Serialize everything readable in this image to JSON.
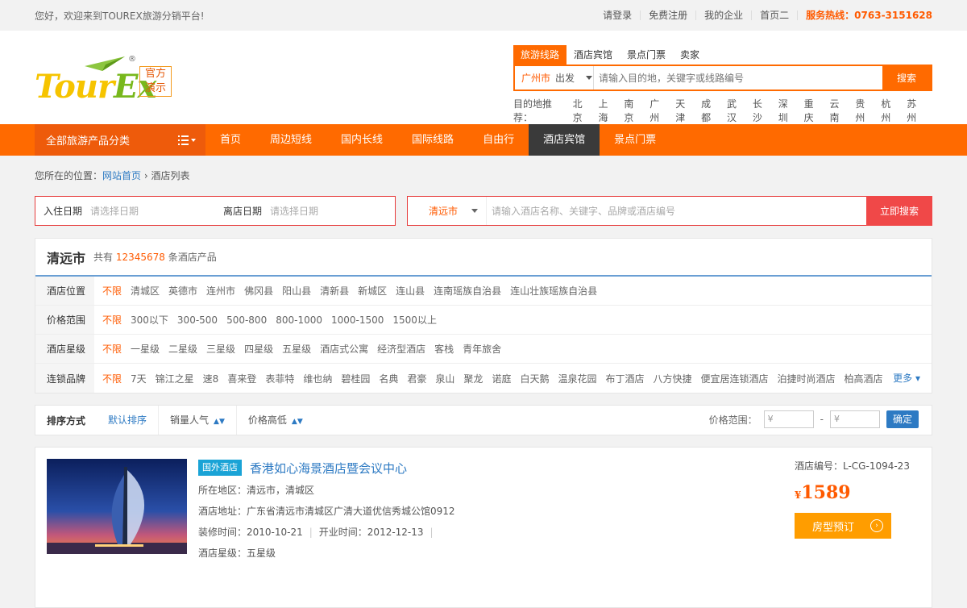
{
  "topbar": {
    "welcome": "您好，欢迎来到TOUREX旅游分销平台!",
    "links": [
      "请登录",
      "免费注册",
      "我的企业",
      "首页二"
    ],
    "hotline": "服务热线：0763-3151628"
  },
  "logo": {
    "text_main": "Tour",
    "text_accent": "Ex",
    "badge_line1": "官方",
    "badge_line2": "演示",
    "mark": "®"
  },
  "search": {
    "tabs": [
      "旅游线路",
      "酒店宾馆",
      "景点门票",
      "卖家"
    ],
    "city": "广州市",
    "depart": "出发",
    "placeholder": "请输入目的地，关键字或线路编号",
    "button": "搜索",
    "hot_label": "目的地推荐：",
    "hot": [
      "北京",
      "上海",
      "南京",
      "广州",
      "天津",
      "成都",
      "武汉",
      "长沙",
      "深圳",
      "重庆",
      "云南",
      "贵州",
      "杭州",
      "苏州"
    ]
  },
  "nav": {
    "categories": "全部旅游产品分类",
    "items": [
      "首页",
      "周边短线",
      "国内长线",
      "国际线路",
      "自由行",
      "酒店宾馆",
      "景点门票"
    ],
    "active_index": 5
  },
  "breadcrumb": {
    "prefix": "您所在的位置：",
    "home": "网站首页",
    "sep": "›",
    "current": "酒店列表"
  },
  "hotel_search": {
    "checkin_label": "入住日期",
    "checkin_placeholder": "请选择日期",
    "checkout_label": "离店日期",
    "checkout_placeholder": "请选择日期",
    "city": "清远市",
    "placeholder": "请输入酒店名称、关键字、品牌或酒店编号",
    "button": "立即搜索"
  },
  "filter": {
    "city": "清远市",
    "count_prefix": "共有",
    "count": "12345678",
    "count_suffix": "条酒店产品",
    "rows": [
      {
        "label": "酒店位置",
        "options": [
          "不限",
          "清城区",
          "英德市",
          "连州市",
          "佛冈县",
          "阳山县",
          "清新县",
          "新城区",
          "连山县",
          "连南瑶族自治县",
          "连山壮族瑶族自治县"
        ]
      },
      {
        "label": "价格范围",
        "options": [
          "不限",
          "300以下",
          "300-500",
          "500-800",
          "800-1000",
          "1000-1500",
          "1500以上"
        ]
      },
      {
        "label": "酒店星级",
        "options": [
          "不限",
          "一星级",
          "二星级",
          "三星级",
          "四星级",
          "五星级",
          "酒店式公寓",
          "经济型酒店",
          "客栈",
          "青年旅舍"
        ]
      },
      {
        "label": "连锁品牌",
        "options": [
          "不限",
          "7天",
          "锦江之星",
          "速8",
          "喜来登",
          "表菲特",
          "维也纳",
          "碧桂园",
          "名典",
          "君豪",
          "泉山",
          "聚龙",
          "诺庭",
          "白天鹅",
          "温泉花园",
          "布丁酒店",
          "八方快捷",
          "便宜居连锁酒店",
          "泊捷时尚酒店",
          "柏高酒店"
        ]
      }
    ],
    "more": "更多"
  },
  "sort": {
    "label": "排序方式",
    "options": [
      "默认排序",
      "销量人气",
      "价格高低"
    ],
    "price_label": "价格范围：",
    "currency": "¥",
    "dash": "-",
    "confirm": "确定"
  },
  "hotel": {
    "badge": "国外酒店",
    "name": "香港如心海景酒店暨会议中心",
    "region": "所在地区：清远市，清城区",
    "address": "酒店地址：广东省清远市清城区广清大道优信秀城公馆0912",
    "renovated": "装修时间：2010-10-21",
    "opened": "开业时间：2012-12-13",
    "stars": "酒店星级：五星级",
    "code": "酒店编号：L-CG-1094-23",
    "currency": "¥",
    "price": "1589",
    "book": "房型预订"
  },
  "colors": {
    "brand": "#ff6a00",
    "link": "#2d7ac3",
    "nav_active": "#3a3a3a",
    "book": "#ff9d00"
  }
}
